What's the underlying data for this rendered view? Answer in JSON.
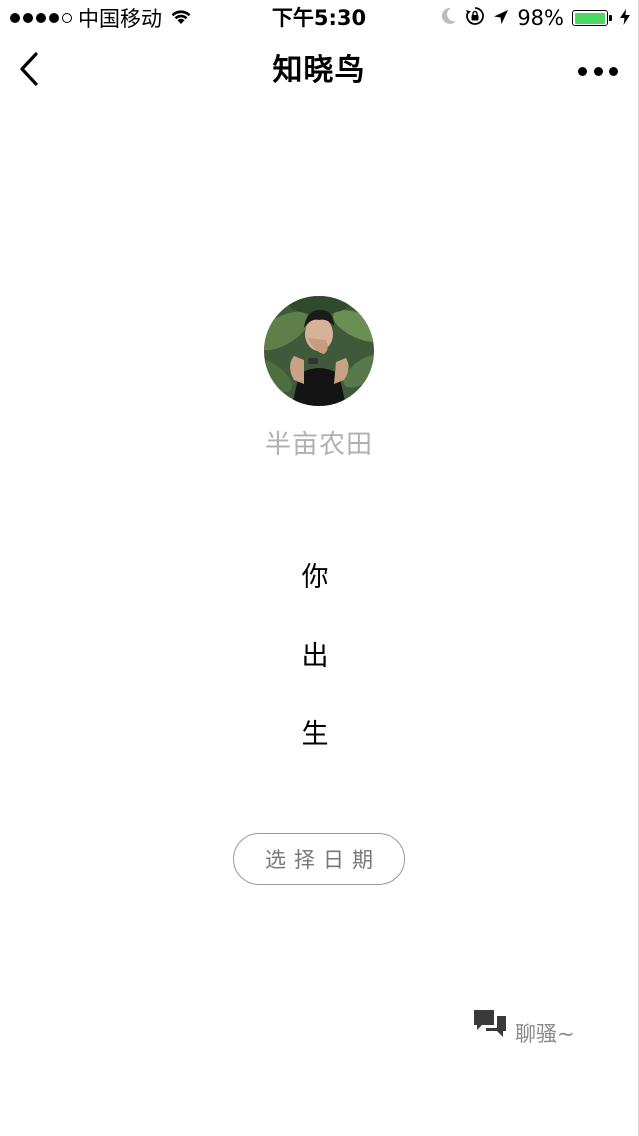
{
  "status_bar": {
    "carrier": "中国移动",
    "time": "下午5:30",
    "battery": "98%",
    "battery_level": 0.98,
    "signal_bars_filled": 4,
    "signal_bars_total": 5
  },
  "nav": {
    "title": "知晓鸟"
  },
  "profile": {
    "name": "半亩农田"
  },
  "prompt": {
    "line1": "你",
    "line2": "出",
    "line3": "生"
  },
  "actions": {
    "select_date": "选择日期",
    "chat": "聊骚~"
  },
  "colors": {
    "battery_fill": "#4cd964",
    "name_text": "#b0b0b0",
    "button_border": "#9a9a9a"
  }
}
